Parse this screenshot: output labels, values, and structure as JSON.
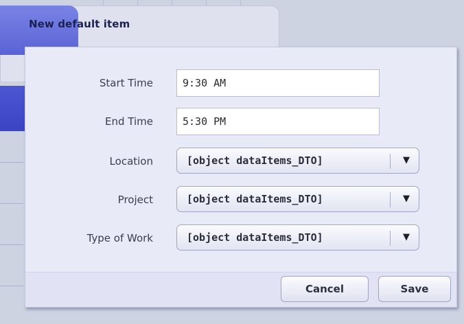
{
  "header": {
    "title": "New default item"
  },
  "form": {
    "start_time": {
      "label": "Start Time",
      "value": "9:30 AM"
    },
    "end_time": {
      "label": "End Time",
      "value": "5:30 PM"
    },
    "location": {
      "label": "Location",
      "selected": "[object dataItems_DTO]"
    },
    "project": {
      "label": "Project",
      "selected": "[object dataItems_DTO]"
    },
    "type_of_work": {
      "label": "Type of Work",
      "selected": "[object dataItems_DTO]"
    }
  },
  "buttons": {
    "cancel_label": "Cancel",
    "save_label": "Save"
  },
  "icons": {
    "dropdown_arrow": "chevron-down-icon"
  },
  "colors": {
    "accent": "#5a63d6",
    "panel_background": "#e9eaf8",
    "page_background": "#d2d6e3"
  }
}
